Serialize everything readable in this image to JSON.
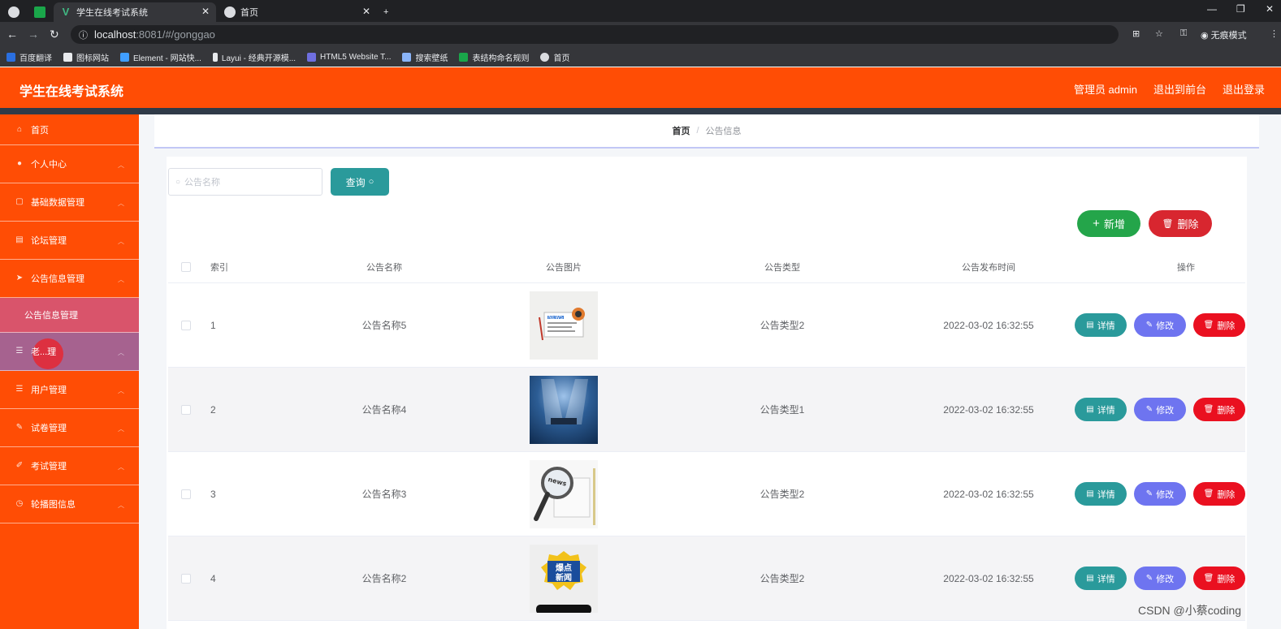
{
  "browser": {
    "tabs": [
      {
        "label": ""
      },
      {
        "label": "学生在线考试系统"
      },
      {
        "label": "首页"
      }
    ],
    "new_tab": "+",
    "url_host": "localhost",
    "url_path": ":8081/#/gonggao",
    "incognito_label": "无痕模式",
    "bookmarks": [
      "百度翻译",
      "图标网站",
      "Element - 网站快...",
      "Layui - 经典开源模...",
      "HTML5 Website T...",
      "搜索壁纸",
      "表结构命名规则",
      "首页"
    ]
  },
  "header": {
    "title": "学生在线考试系统",
    "user": "管理员 admin",
    "to_front": "退出到前台",
    "logout": "退出登录"
  },
  "sidebar": {
    "items": [
      {
        "label": "首页",
        "icon": "home-icon"
      },
      {
        "label": "个人中心",
        "icon": "user-icon"
      },
      {
        "label": "基础数据管理",
        "icon": "data-icon"
      },
      {
        "label": "论坛管理",
        "icon": "forum-icon"
      },
      {
        "label": "公告信息管理",
        "icon": "notice-icon"
      },
      {
        "label": "公告信息管理",
        "icon": ""
      },
      {
        "label": "老...理",
        "icon": "teacher-icon"
      },
      {
        "label": "用户管理",
        "icon": "users-icon"
      },
      {
        "label": "试卷管理",
        "icon": "paper-icon"
      },
      {
        "label": "考试管理",
        "icon": "exam-icon"
      },
      {
        "label": "轮播图信息",
        "icon": "carousel-icon"
      }
    ]
  },
  "breadcrumb": {
    "home": "首页",
    "sep": "/",
    "current": "公告信息"
  },
  "toolbar": {
    "search_placeholder": "公告名称",
    "query_label": "查询",
    "add_label": "新增",
    "delete_label": "删除"
  },
  "table": {
    "headers": [
      "索引",
      "公告名称",
      "公告图片",
      "公告类型",
      "公告发布时间",
      "操作"
    ],
    "rows": [
      {
        "index": "1",
        "name": "公告名称5",
        "type": "公告类型2",
        "time": "2022-03-02 16:32:55"
      },
      {
        "index": "2",
        "name": "公告名称4",
        "type": "公告类型1",
        "time": "2022-03-02 16:32:55"
      },
      {
        "index": "3",
        "name": "公告名称3",
        "type": "公告类型2",
        "time": "2022-03-02 16:32:55"
      },
      {
        "index": "4",
        "name": "公告名称2",
        "type": "公告类型2",
        "time": "2022-03-02 16:32:55"
      }
    ],
    "ops": {
      "detail": "详情",
      "edit": "修改",
      "remove": "删除"
    }
  },
  "thumb_text": {
    "t1": "NEWS",
    "t3": "news",
    "t4a": "爆点",
    "t4b": "新闻"
  },
  "watermark": "CSDN @小蔡coding",
  "colors": {
    "brand": "#ff4d05",
    "teal": "#2a9a9b",
    "green": "#24a54a",
    "red": "#d8262f",
    "purple": "#6e74f0"
  }
}
